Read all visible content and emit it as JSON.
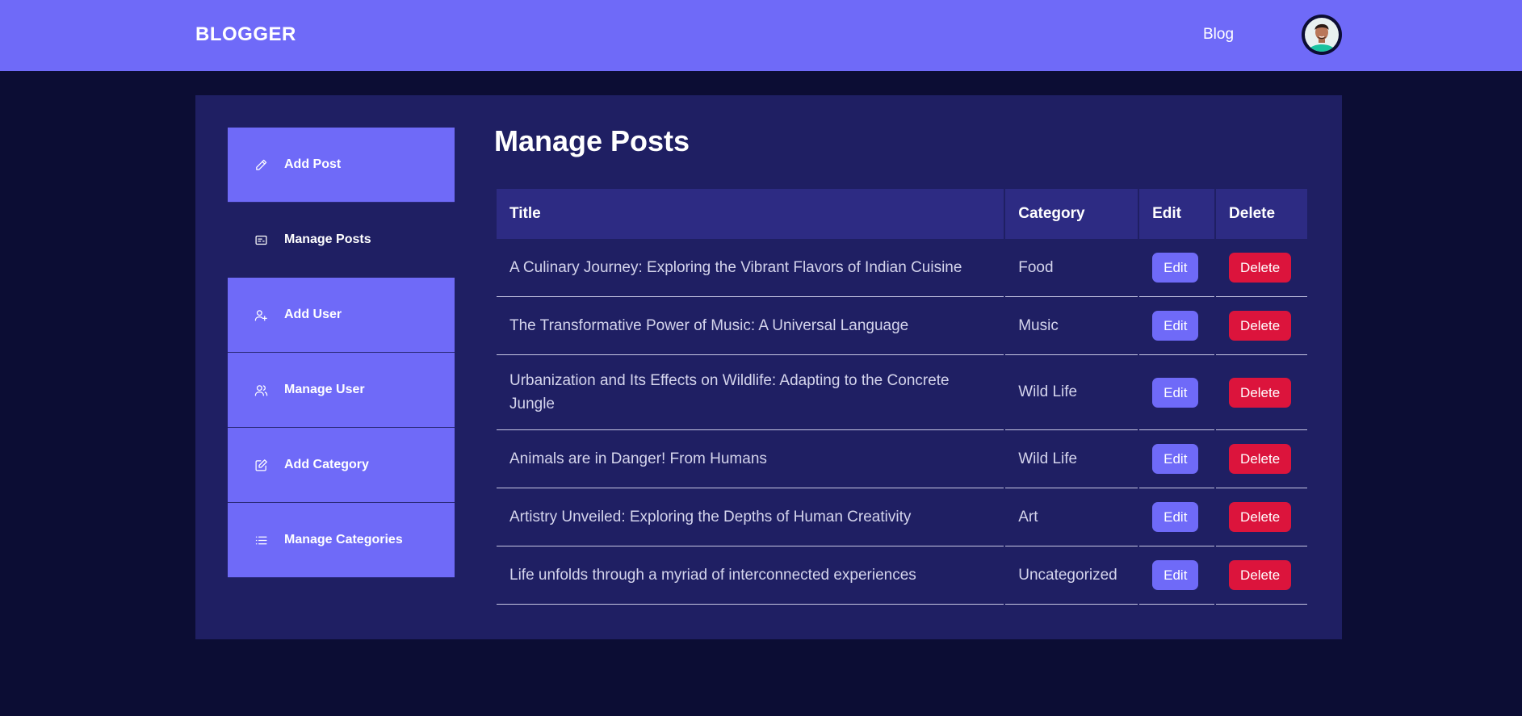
{
  "navbar": {
    "logo": "BLOGGER",
    "links": [
      "Blog"
    ]
  },
  "sidebar": {
    "items": [
      {
        "label": "Add Post",
        "icon": "pencil-icon",
        "active": false
      },
      {
        "label": "Manage Posts",
        "icon": "posts-icon",
        "active": true
      },
      {
        "label": "Add User",
        "icon": "user-plus-icon",
        "active": false
      },
      {
        "label": "Manage User",
        "icon": "users-icon",
        "active": false
      },
      {
        "label": "Add Category",
        "icon": "edit-square-icon",
        "active": false
      },
      {
        "label": "Manage Categories",
        "icon": "list-icon",
        "active": false
      }
    ]
  },
  "main": {
    "title": "Manage Posts",
    "table": {
      "headers": [
        "Title",
        "Category",
        "Edit",
        "Delete"
      ],
      "rows": [
        {
          "title": "A Culinary Journey: Exploring the Vibrant Flavors of Indian Cuisine",
          "category": "Food",
          "edit": "Edit",
          "delete": "Delete"
        },
        {
          "title": "The Transformative Power of Music: A Universal Language",
          "category": "Music",
          "edit": "Edit",
          "delete": "Delete"
        },
        {
          "title": "Urbanization and Its Effects on Wildlife: Adapting to the Concrete Jungle",
          "category": "Wild Life",
          "edit": "Edit",
          "delete": "Delete"
        },
        {
          "title": "Animals are in Danger! From Humans",
          "category": "Wild Life",
          "edit": "Edit",
          "delete": "Delete"
        },
        {
          "title": "Artistry Unveiled: Exploring the Depths of Human Creativity",
          "category": "Art",
          "edit": "Edit",
          "delete": "Delete"
        },
        {
          "title": "Life unfolds through a myriad of interconnected experiences",
          "category": "Uncategorized",
          "edit": "Edit",
          "delete": "Delete"
        }
      ]
    }
  },
  "colors": {
    "background": "#0c0d34",
    "navbar": "#6f6af8",
    "panel": "#1f1f63",
    "table_header": "#2d2b83",
    "edit_button": "#6f6af8",
    "delete_button": "#dc143c"
  }
}
